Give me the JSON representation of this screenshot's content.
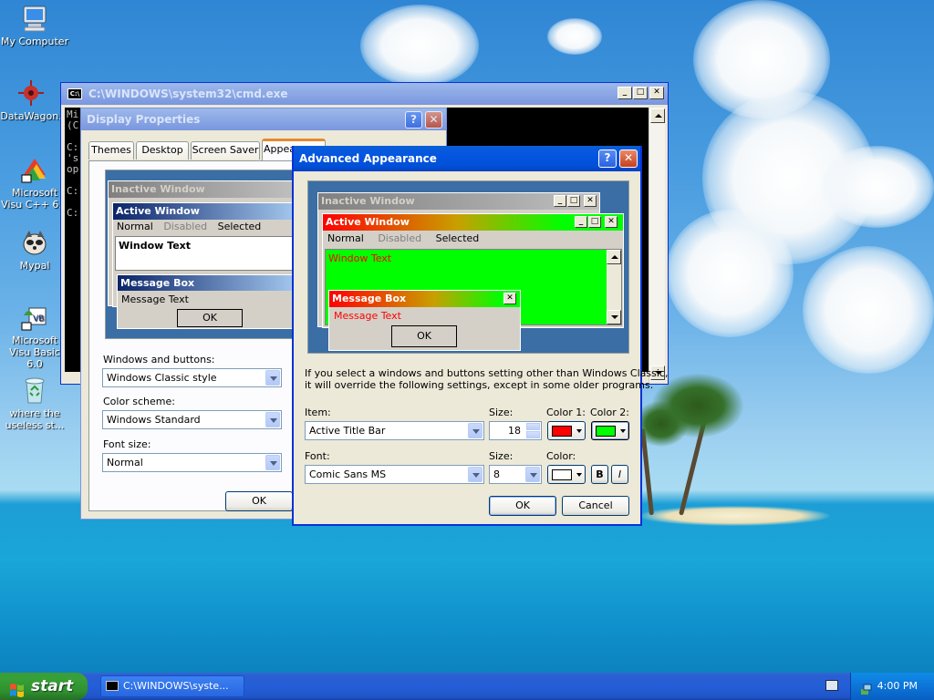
{
  "desktop": {
    "icons": [
      {
        "name": "my-computer",
        "label": "My Computer"
      },
      {
        "name": "datawagon",
        "label": "DataWagon."
      },
      {
        "name": "msvc",
        "label": "Microsoft Visu C++ 6.0"
      },
      {
        "name": "mypal",
        "label": "Mypal"
      },
      {
        "name": "msvb",
        "label": "Microsoft Visu Basic 6.0"
      },
      {
        "name": "recycle-bin",
        "label": "where the useless st..."
      }
    ]
  },
  "cmd": {
    "title": "C:\\WINDOWS\\system32\\cmd.exe",
    "lines": [
      "Mi",
      "(C",
      "",
      "C:",
      "'s",
      "op",
      "",
      "C:",
      "",
      "C:"
    ]
  },
  "display_properties": {
    "title": "Display Properties",
    "tabs": [
      "Themes",
      "Desktop",
      "Screen Saver",
      "Appearance"
    ],
    "preview": {
      "inactive_title": "Inactive Window",
      "active_title": "Active Window",
      "menu": [
        "Normal",
        "Disabled",
        "Selected"
      ],
      "window_text": "Window Text",
      "message_box_title": "Message Box",
      "message_text": "Message Text",
      "ok": "OK"
    },
    "windows_buttons_label": "Windows and buttons:",
    "windows_buttons_value": "Windows Classic style",
    "color_scheme_label": "Color scheme:",
    "color_scheme_value": "Windows Standard",
    "font_size_label": "Font size:",
    "font_size_value": "Normal",
    "ok_label": "OK"
  },
  "advanced": {
    "title": "Advanced Appearance",
    "preview": {
      "inactive_title": "Inactive Window",
      "active_title": "Active Window",
      "menu": [
        "Normal",
        "Disabled",
        "Selected"
      ],
      "window_text": "Window Text",
      "message_box_title": "Message Box",
      "message_text": "Message Text",
      "ok": "OK"
    },
    "info_text_1": "If you select a windows and buttons setting other than Windows Classic,",
    "info_text_2": "it will override the following settings, except in some older programs.",
    "item_label": "Item:",
    "item_value": "Active Title Bar",
    "item_size_label": "Size:",
    "item_size_value": "18",
    "color1_label": "Color 1:",
    "color2_label": "Color 2:",
    "font_label": "Font:",
    "font_value": "Comic Sans MS",
    "font_size_label": "Size:",
    "font_size_value": "8",
    "font_color_label": "Color:",
    "bold_label": "B",
    "italic_label": "I",
    "ok_label": "OK",
    "cancel_label": "Cancel"
  },
  "taskbar": {
    "start_label": "start",
    "task_label": "C:\\WINDOWS\\syste...",
    "clock": "4:00 PM"
  },
  "colors": {
    "color1": "#ff0000",
    "color2": "#00ff00",
    "font_color": "#ffffff",
    "active_title_red": "#ff0000",
    "active_title_green": "#00ff00",
    "window_bg": "#00ff00"
  }
}
